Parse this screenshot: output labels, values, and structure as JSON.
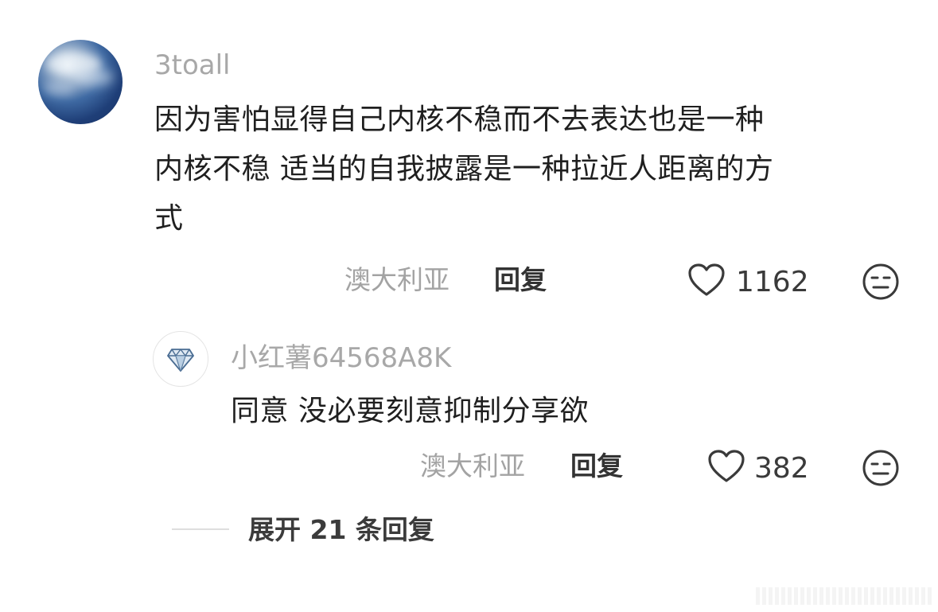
{
  "comment": {
    "username": "3toall",
    "lines": [
      "因为害怕显得自己内核不稳而不去表达也是一种",
      "内核不稳 适当的自我披露是一种拉近人距离的方",
      "式"
    ],
    "location": "澳大利亚",
    "reply_label": "回复",
    "likes": "1162",
    "icons": {
      "avatar": "sky-cloud-avatar",
      "like": "heart-outline-icon",
      "emoji": "neutral-face-icon"
    }
  },
  "reply": {
    "username": "小红薯64568A8K",
    "text": "同意 没必要刻意抑制分享欲",
    "location": "澳大利亚",
    "reply_label": "回复",
    "likes": "382",
    "icons": {
      "avatar": "diamond-icon",
      "like": "heart-outline-icon",
      "emoji": "neutral-face-icon"
    }
  },
  "expand": {
    "label": "展开 21 条回复"
  },
  "colors": {
    "username": "#a8a8a8",
    "text": "#1f1f1f",
    "meta": "#a3a3a3",
    "reply": "#333333"
  }
}
